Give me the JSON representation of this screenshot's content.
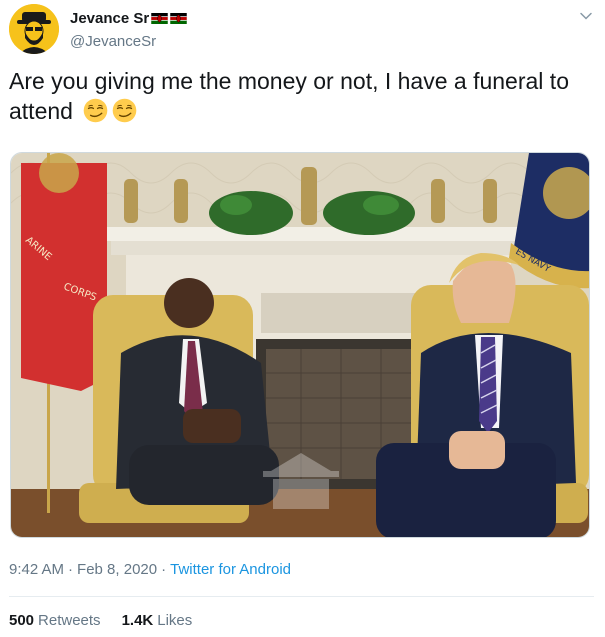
{
  "user": {
    "display_name": "Jevance Sr",
    "handle": "@JevanceSr",
    "flags": [
      "kenya-flag-icon",
      "kenya-flag-icon"
    ],
    "avatar_color": "#f6c21b"
  },
  "tweet": {
    "text": "Are you giving me the money or not, I have a funeral to attend",
    "emojis": [
      "smirking-face-icon",
      "smirking-face-icon"
    ]
  },
  "media": {
    "flag_left_text": "ARINE CORPS",
    "flag_right_text": "ES NAVY"
  },
  "meta": {
    "time": "9:42 AM",
    "separator": "·",
    "date": "Feb 8, 2020",
    "source": "Twitter for Android"
  },
  "stats": {
    "retweets_count": "500",
    "retweets_label": "Retweets",
    "likes_count": "1.4K",
    "likes_label": "Likes"
  },
  "colors": {
    "text": "#14171a",
    "secondary": "#657786",
    "link": "#1b95e0",
    "divider": "#e6ecf0"
  }
}
